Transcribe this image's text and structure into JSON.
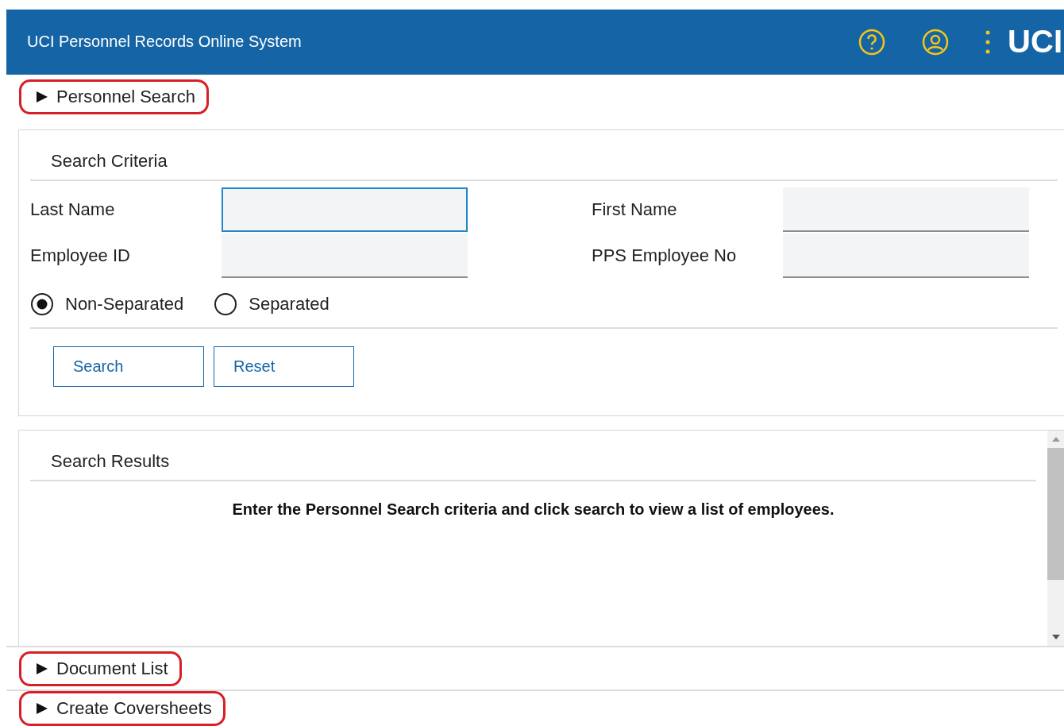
{
  "header": {
    "title": "UCI Personnel Records Online System",
    "logo": "UCI"
  },
  "sections": [
    {
      "label": "Personnel Search",
      "highlighted": true
    },
    {
      "label": "Document List",
      "highlighted": true
    },
    {
      "label": "Create Coversheets",
      "highlighted": true
    }
  ],
  "search_criteria": {
    "title": "Search Criteria",
    "fields": [
      {
        "label": "Last Name",
        "focused": true
      },
      {
        "label": "First Name",
        "focused": false
      },
      {
        "label": "Employee ID",
        "focused": false
      },
      {
        "label": "PPS Employee No",
        "focused": false
      }
    ],
    "status_options": [
      {
        "label": "Non-Separated",
        "selected": true
      },
      {
        "label": "Separated",
        "selected": false
      }
    ],
    "buttons": [
      "Search",
      "Reset"
    ]
  },
  "search_results": {
    "title": "Search Results",
    "message": "Enter the Personnel Search criteria and click search to view a list of employees."
  }
}
